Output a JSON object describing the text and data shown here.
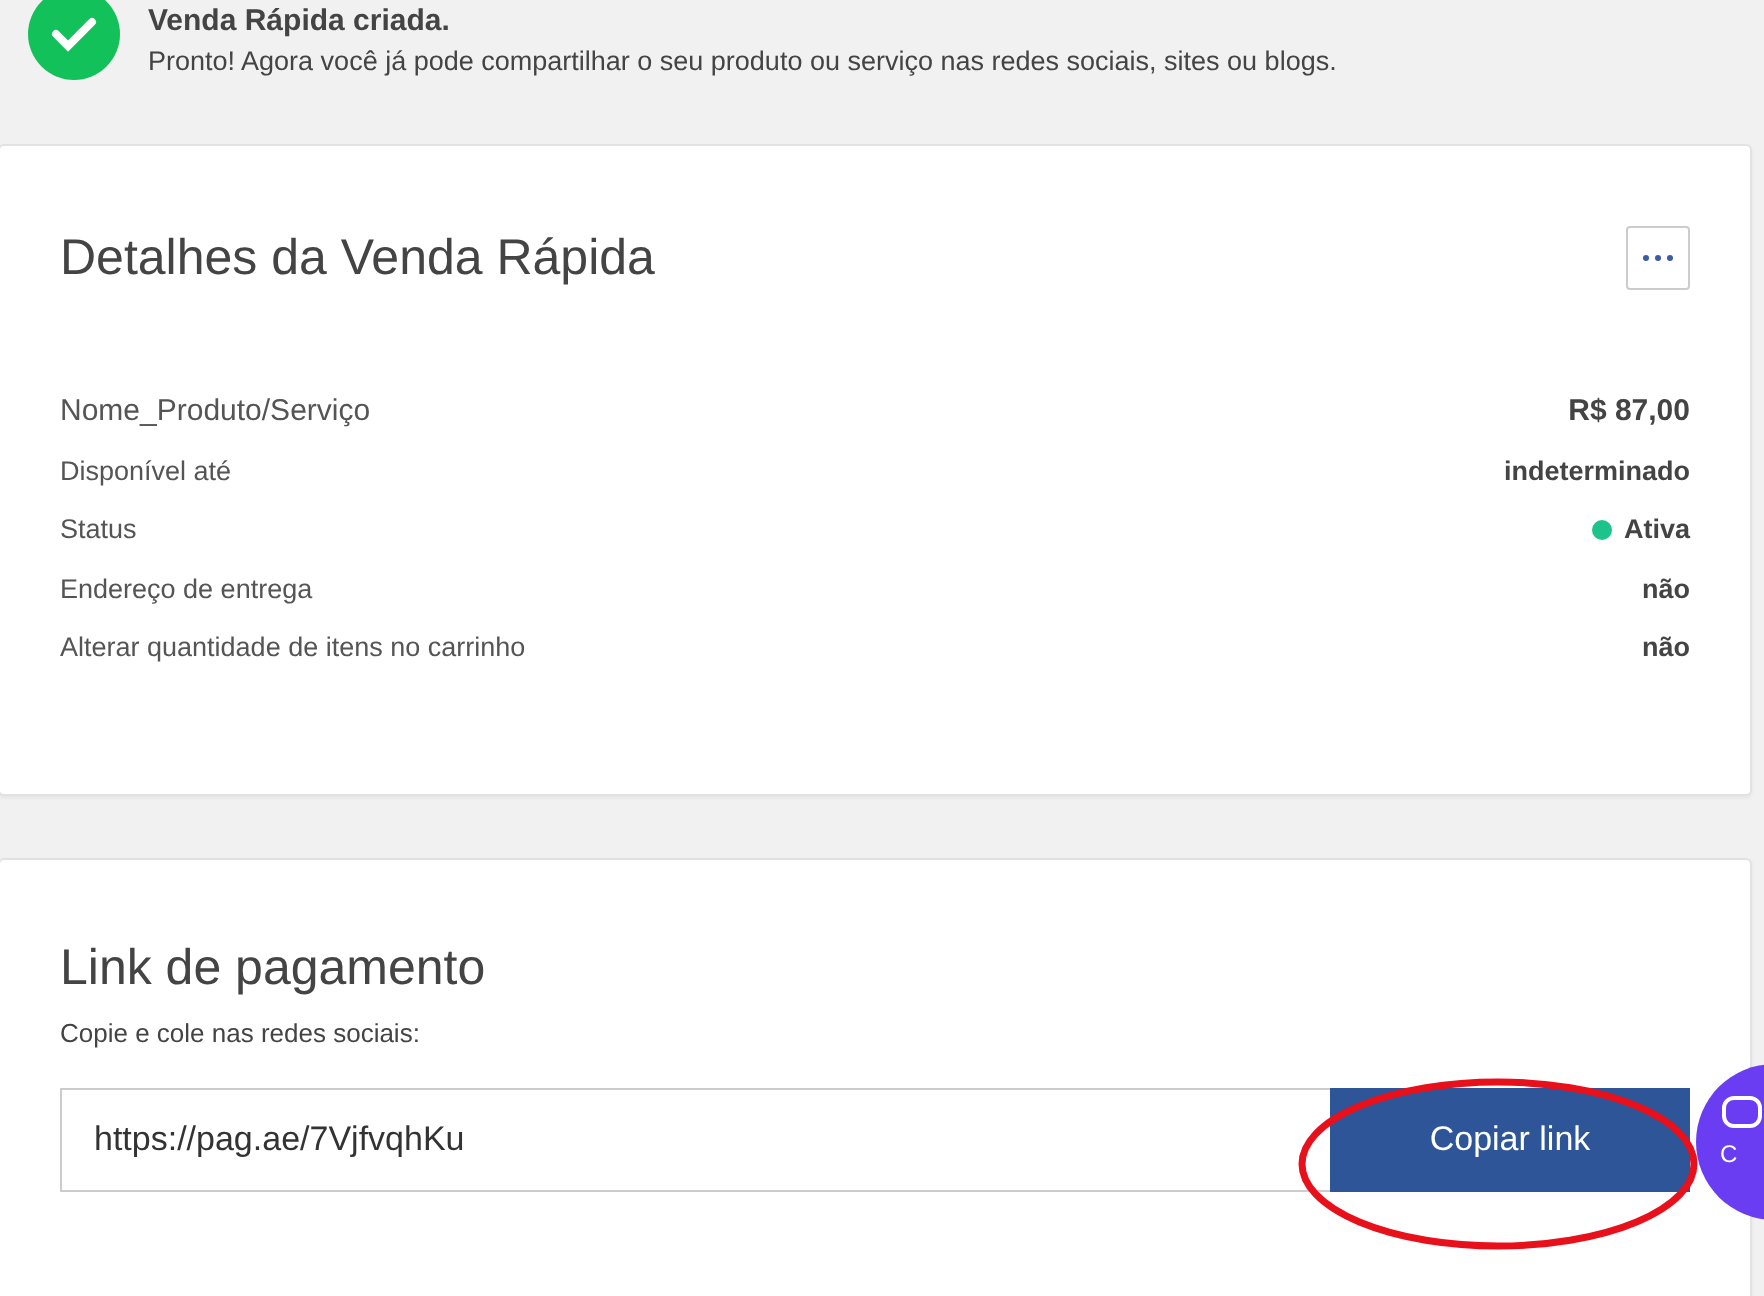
{
  "notice": {
    "title": "Venda Rápida criada.",
    "message": "Pronto! Agora você já pode compartilhar o seu produto ou serviço nas redes sociais, sites ou blogs."
  },
  "details": {
    "title": "Detalhes da Venda Rápida",
    "rows": [
      {
        "kind": "product",
        "label": "Nome_Produto/Serviço",
        "value": "R$ 87,00"
      },
      {
        "kind": "plain",
        "label": "Disponível até",
        "value": "indeterminado"
      },
      {
        "kind": "status",
        "label": "Status",
        "value": "Ativa",
        "color": "#1ec28b"
      },
      {
        "kind": "plain",
        "label": "Endereço de entrega",
        "value": "não"
      },
      {
        "kind": "plain",
        "label": "Alterar quantidade de itens no carrinho",
        "value": "não"
      }
    ]
  },
  "payment_link": {
    "title": "Link de pagamento",
    "hint": "Copie e cole nas redes sociais:",
    "value": "https://pag.ae/7VjfvqhKu",
    "button": "Copiar link"
  },
  "chat_button": {
    "label": "C"
  }
}
